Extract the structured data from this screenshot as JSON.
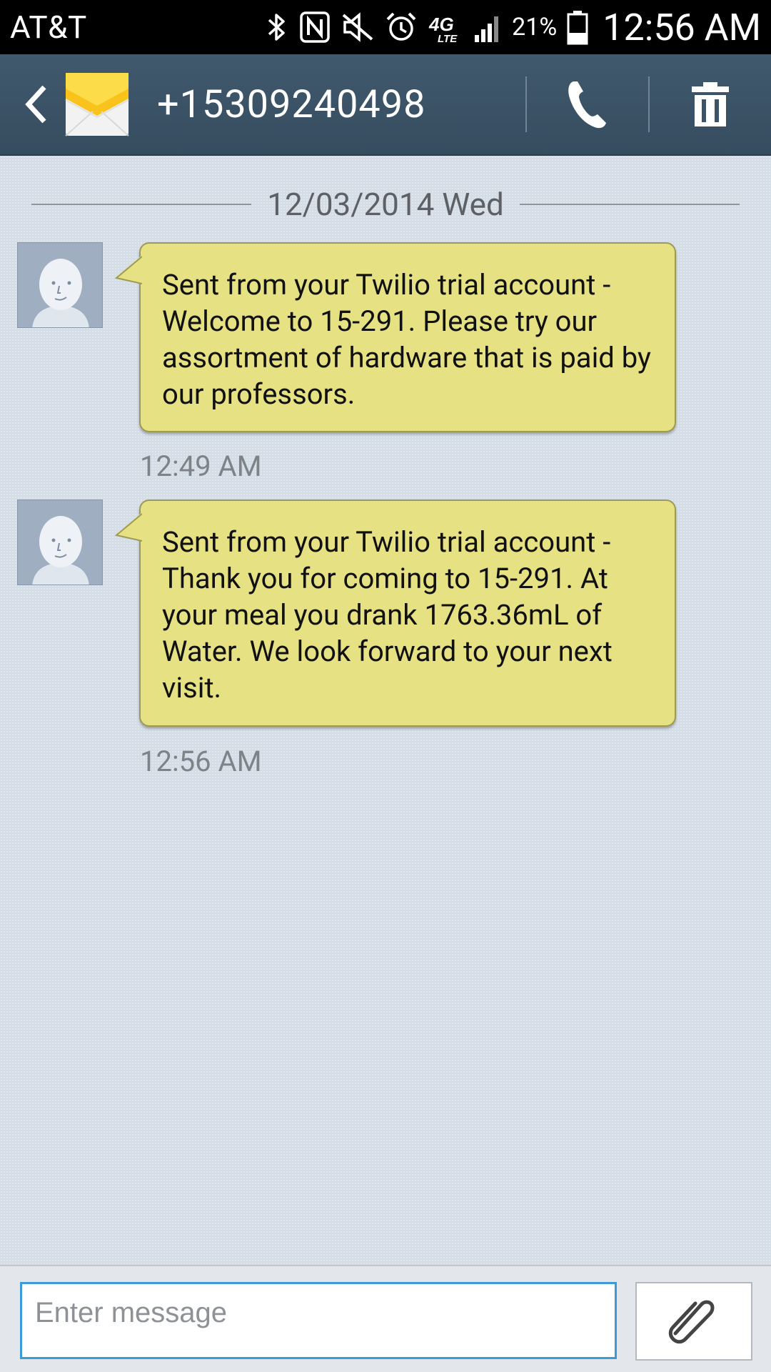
{
  "status_bar": {
    "carrier": "AT&T",
    "battery_percent": "21%",
    "time": "12:56 AM",
    "icons": [
      "bluetooth-icon",
      "nfc-icon",
      "mute-icon",
      "alarm-icon",
      "4g-lte-icon",
      "signal-icon",
      "battery-icon"
    ]
  },
  "header": {
    "contact": "+15309240498",
    "icons": [
      "back-icon",
      "envelope-icon",
      "phone-icon",
      "trash-icon"
    ]
  },
  "conversation": {
    "date_separator": "12/03/2014 Wed",
    "messages": [
      {
        "text": "Sent from your Twilio trial account - Welcome to 15-291. Please try our assortment of hardware that is paid by our professors.",
        "time": "12:49 AM"
      },
      {
        "text": "Sent from your Twilio trial account - Thank you for coming to 15-291. At your meal you drank 1763.36mL of Water. We look forward to your next visit.",
        "time": "12:56 AM"
      }
    ]
  },
  "composer": {
    "placeholder": "Enter message",
    "value": "",
    "attach_icon": "paperclip-icon"
  },
  "colors": {
    "header": "#3d5468",
    "bubble": "#e6e283",
    "input_border": "#3c9bd6",
    "background": "#d4dde6"
  }
}
